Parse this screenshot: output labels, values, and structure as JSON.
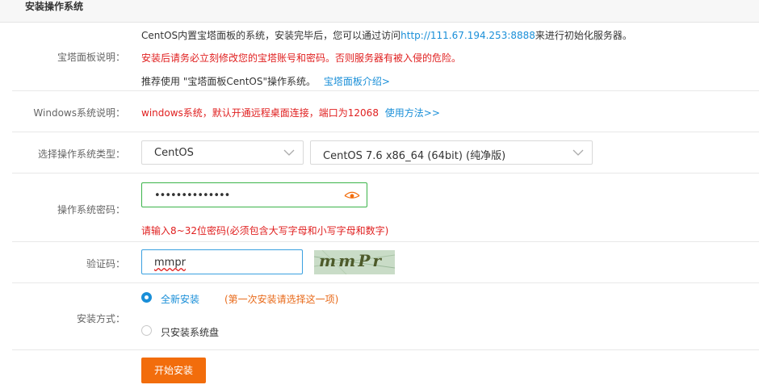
{
  "section_title": "安装操作系统",
  "baota": {
    "label": "宝塔面板说明：",
    "line1_prefix": "CentOS内置宝塔面板的系统，安装完毕后，您可以通过访问",
    "line1_link": "http://111.67.194.253:8888",
    "line1_suffix": "来进行初始化服务器。",
    "line2": "安装后请务必立刻修改您的宝塔账号和密码。否则服务器有被入侵的危险。",
    "line3_prefix": "推荐使用 \"宝塔面板CentOS\"操作系统。",
    "line3_link": "宝塔面板介绍>"
  },
  "windows": {
    "label": "Windows系统说明：",
    "text": "windows系统，默认开通远程桌面连接，端口为12068",
    "link": "使用方法>>"
  },
  "os_type": {
    "label": "选择操作系统类型：",
    "family": "CentOS",
    "version": "CentOS 7.6 x86_64 (64bit) (纯净版)"
  },
  "password": {
    "label": "操作系统密码：",
    "value": "••••••••••••••",
    "hint": "请输入8~32位密码(必须包含大写字母和小写字母和数字)"
  },
  "captcha": {
    "label": "验证码：",
    "value": "mmpr",
    "image_text": "mmPr"
  },
  "install": {
    "label": "安装方式：",
    "option1": "全新安装",
    "option1_note": "(第一次安装请选择这一项)",
    "option2": "只安装系统盘"
  },
  "submit_label": "开始安装",
  "colors": {
    "accent_blue": "#1a8fd8",
    "warning_red": "#e02020",
    "note_orange": "#e86a1a",
    "button_orange": "#f26d0c",
    "valid_green": "#3bb44a"
  }
}
